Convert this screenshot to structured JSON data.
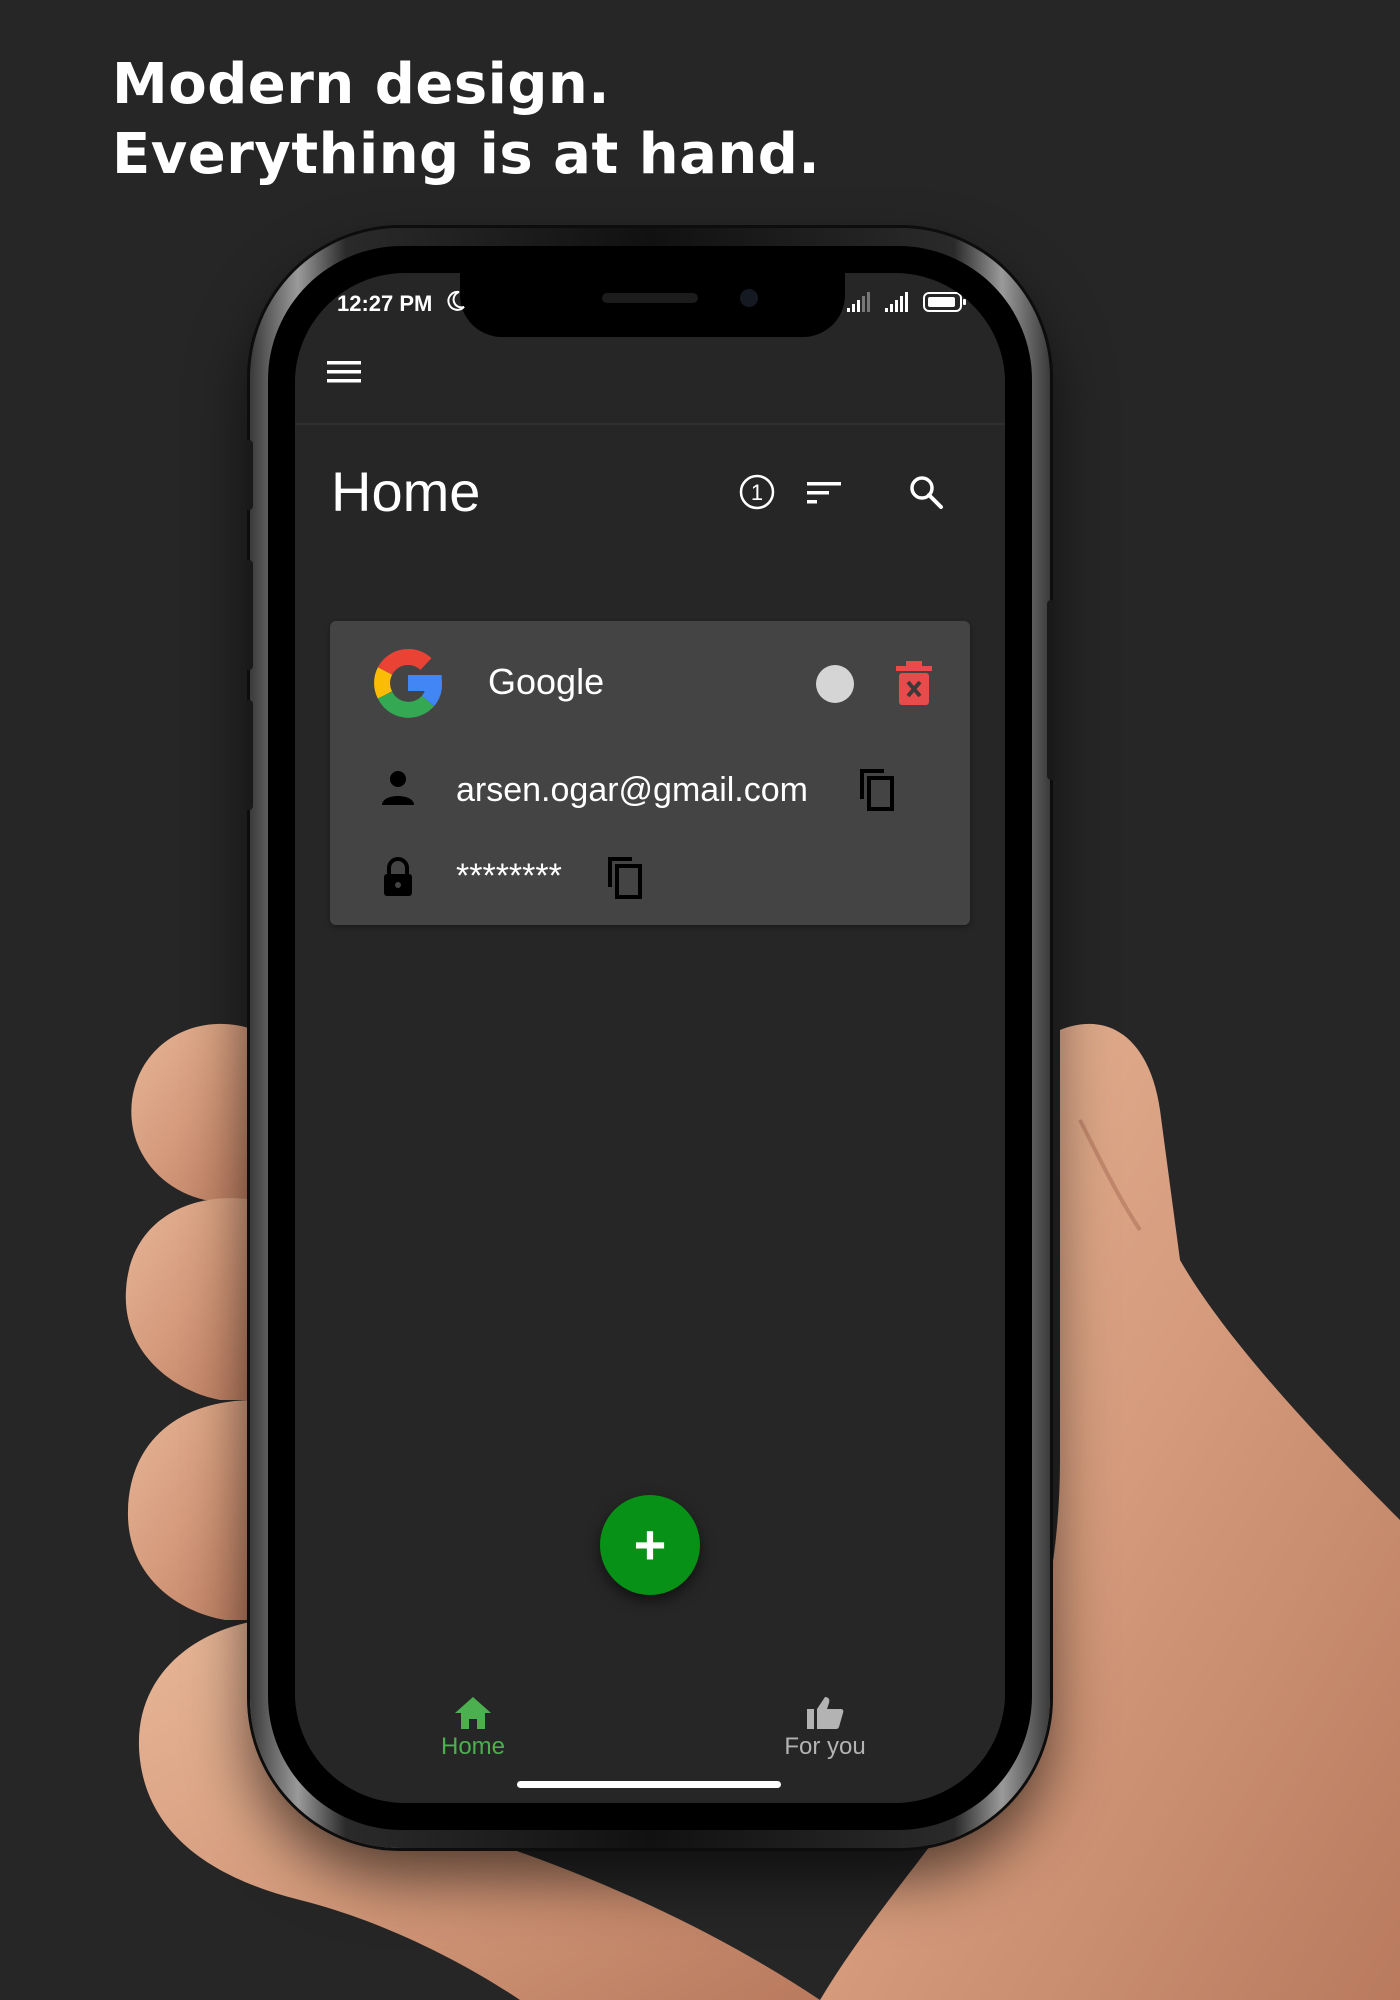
{
  "headline": {
    "line1": "Modern design.",
    "line2": "Everything is at hand."
  },
  "status_bar": {
    "time": "12:27 PM"
  },
  "home": {
    "title": "Home",
    "count_badge": "1"
  },
  "card": {
    "service_name": "Google",
    "email": "arsen.ogar@gmail.com",
    "password_masked": "********"
  },
  "fab": {
    "label": "+"
  },
  "bottom_nav": {
    "items": [
      {
        "label": "Home",
        "icon": "home-icon",
        "active": true
      },
      {
        "label": "For you",
        "icon": "thumb-up-icon",
        "active": false
      }
    ]
  },
  "colors": {
    "background": "#262626",
    "card": "#444444",
    "accent_green": "#079117",
    "nav_active": "#4caf50",
    "nav_inactive": "#b3b3b3",
    "delete_red": "#e84b4b"
  }
}
